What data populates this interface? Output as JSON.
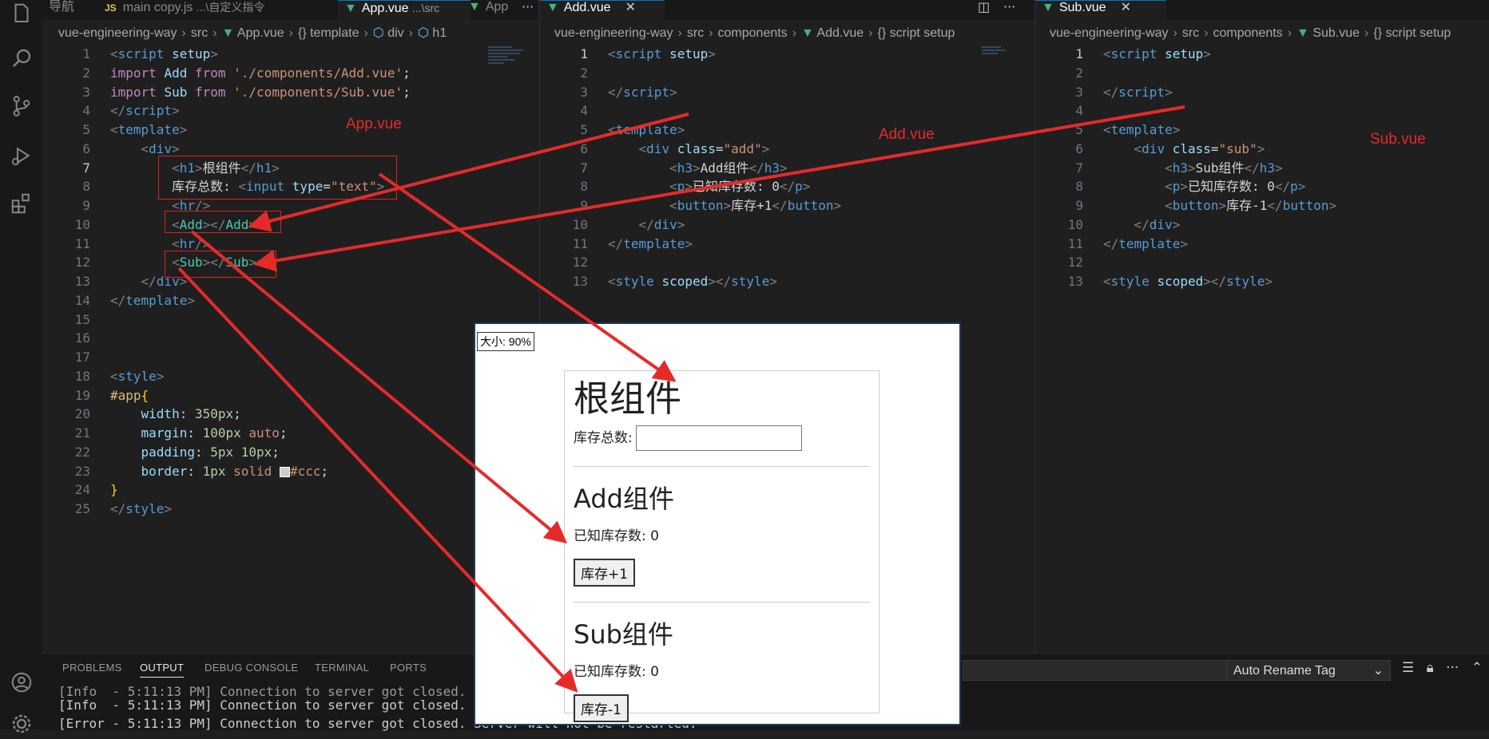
{
  "activity_bar": {
    "icons": [
      "files-icon",
      "search-icon",
      "source-control-icon",
      "run-debug-icon",
      "extensions-icon",
      "account-icon",
      "gear-icon"
    ]
  },
  "pane1": {
    "tabs": [
      {
        "label": "导航"
      },
      {
        "icon": "JS",
        "label": "main copy.js",
        "desc": "...\\自定义指令"
      },
      {
        "label": "App.vue",
        "desc": "...\\src"
      },
      {
        "label": "App"
      }
    ],
    "breadcrumbs": [
      "vue-engineering-way",
      "src",
      "App.vue",
      "{} template",
      "div",
      "h1"
    ],
    "current_line": 7
  },
  "pane2": {
    "tab": {
      "label": "Add.vue"
    },
    "breadcrumbs": [
      "vue-engineering-way",
      "src",
      "components",
      "Add.vue",
      "{} script setup"
    ],
    "current_line": 1
  },
  "pane3": {
    "tab": {
      "label": "Sub.vue"
    },
    "breadcrumbs": [
      "vue-engineering-way",
      "src",
      "components",
      "Sub.vue",
      "{} script setup"
    ],
    "current_line": 1
  },
  "annotations": {
    "app_label": "App.vue",
    "add_label": "Add.vue",
    "sub_label": "Sub.vue"
  },
  "panel": {
    "tabs": [
      "PROBLEMS",
      "OUTPUT",
      "DEBUG CONSOLE",
      "TERMINAL",
      "PORTS"
    ],
    "active_tab": "OUTPUT",
    "channel": "Auto Rename Tag",
    "log": [
      "[Info  - 5:11:13 PM] Connection to server got closed.",
      "[Info  - 5:11:13 PM] Connection to server got closed.",
      "[Error - 5:11:13 PM] Connection to server got closed. Server will not be restarted."
    ]
  },
  "browser": {
    "zoom": "大小: 90%",
    "root_title": "根组件",
    "stock_label": "库存总数:",
    "add_title": "Add组件",
    "add_known": "已知库存数: 0",
    "add_button": "库存+1",
    "sub_title": "Sub组件",
    "sub_known": "已知库存数: 0",
    "sub_button": "库存-1"
  },
  "colors": {
    "editor_bg": "#1f1f1f",
    "activity_bg": "#181818",
    "annotation_red": "#e62a2a",
    "accent": "#0078d4"
  }
}
